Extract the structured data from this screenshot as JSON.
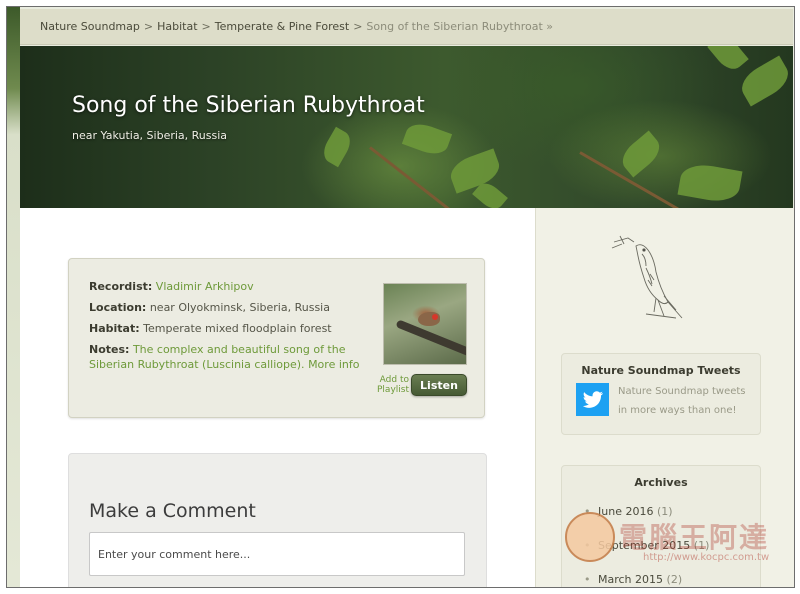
{
  "breadcrumb": {
    "items": [
      "Nature Soundmap",
      "Habitat",
      "Temperate & Pine Forest"
    ],
    "separator": ">",
    "current": "Song of the Siberian Rubythroat »"
  },
  "hero": {
    "title": "Song of the Siberian Rubythroat",
    "subtitle": "near Yakutia, Siberia, Russia"
  },
  "recording": {
    "recordist_label": "Recordist:",
    "recordist_value": "Vladimir Arkhipov",
    "location_label": "Location:",
    "location_value": "near Olyokminsk, Siberia, Russia",
    "habitat_label": "Habitat:",
    "habitat_value": "Temperate mixed floodplain forest",
    "notes_label": "Notes:",
    "notes_value": "The complex and beautiful song of the Siberian Rubythroat (Luscinia calliope).",
    "more_info": "More info",
    "add_to_playlist": "Add to Playlist",
    "listen": "Listen"
  },
  "comment": {
    "heading": "Make a Comment",
    "placeholder": "Enter your comment here..."
  },
  "sidebar": {
    "tweets": {
      "title": "Nature Soundmap Tweets",
      "text": "Nature Soundmap tweets in more ways than one!",
      "icon": "twitter-bird-icon"
    },
    "archives": {
      "title": "Archives",
      "items": [
        {
          "label": "June 2016",
          "count": "(1)"
        },
        {
          "label": "September 2015",
          "count": "(1)"
        },
        {
          "label": "March 2015",
          "count": "(2)"
        }
      ]
    }
  },
  "watermark": {
    "text": "電腦王阿達",
    "url": "http://www.kocpc.com.tw"
  },
  "colors": {
    "accent_green": "#6e9a3a",
    "listen_button": "#4e6238",
    "twitter_blue": "#1da1f2",
    "breadcrumb_bg": "#ddddc9"
  }
}
